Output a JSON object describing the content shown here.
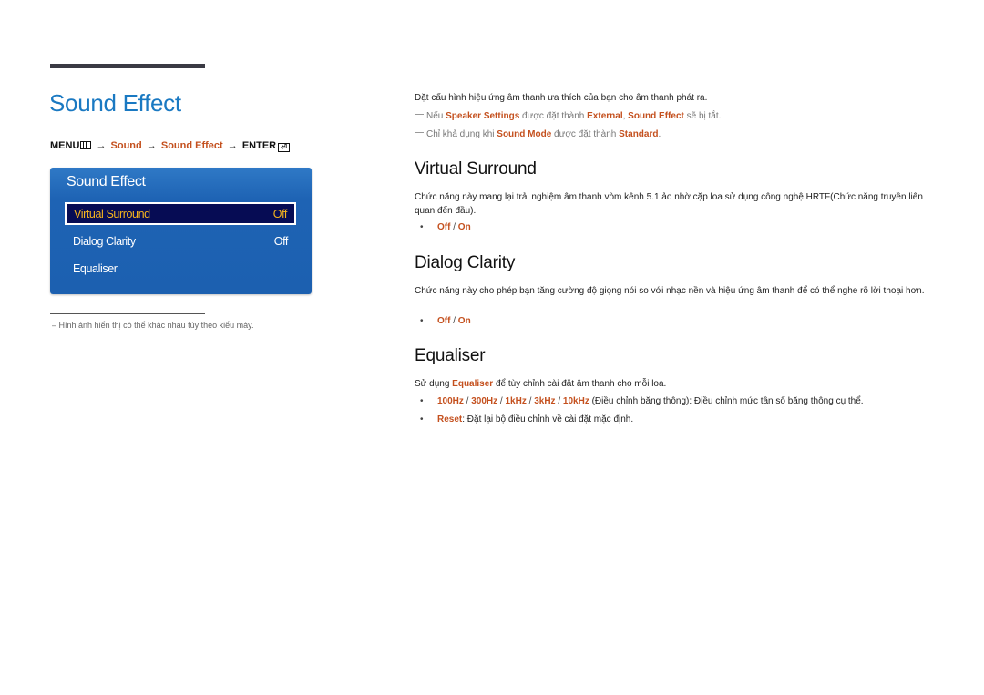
{
  "page": {
    "title": "Sound Effect",
    "menu_path": {
      "menu": "MENU",
      "arrow": "→",
      "sound": "Sound",
      "sound_effect": "Sound Effect",
      "enter": "ENTER",
      "menu_icon": "menu-icon",
      "enter_icon": "enter-icon"
    }
  },
  "osd": {
    "title": "Sound Effect",
    "items": [
      {
        "label": "Virtual Surround",
        "value": "Off",
        "selected": true
      },
      {
        "label": "Dialog Clarity",
        "value": "Off",
        "selected": false
      },
      {
        "label": "Equaliser",
        "value": "",
        "selected": false
      }
    ]
  },
  "footnote": "Hình ảnh hiển thị có thể khác nhau tùy theo kiểu máy.",
  "footnote_dash": "–",
  "intro": {
    "text": "Đặt cấu hình hiệu ứng âm thanh ưa thích của bạn cho âm thanh phát ra.",
    "note1": {
      "p1": "Nếu ",
      "k1": "Speaker Settings",
      "p2": " được đặt thành ",
      "k2": "External",
      "p3": ", ",
      "k3": "Sound Effect",
      "p4": " sẽ bị tắt."
    },
    "note2": {
      "p1": "Chỉ khả dụng khi ",
      "k1": "Sound Mode",
      "p2": " được đặt thành ",
      "k2": "Standard",
      "p3": "."
    }
  },
  "sections": {
    "virtual_surround": {
      "title": "Virtual Surround",
      "desc": "Chức năng này mang lại trải nghiệm âm thanh vòm kênh 5.1 ảo nhờ cặp loa sử dụng công nghệ HRTF(Chức năng truyền liên quan đến đầu).",
      "options": {
        "off": "Off",
        "sep": " / ",
        "on": "On"
      }
    },
    "dialog_clarity": {
      "title": "Dialog Clarity",
      "desc": "Chức năng này cho phép bạn tăng cường độ giọng nói so với nhạc nền và hiệu ứng âm thanh để có thể nghe rõ lời thoại hơn.",
      "options": {
        "off": "Off",
        "sep": " / ",
        "on": "On"
      }
    },
    "equaliser": {
      "title": "Equaliser",
      "desc": {
        "p1": "Sử dụng ",
        "k1": "Equaliser",
        "p2": " để tùy chỉnh cài đặt âm thanh cho mỗi loa."
      },
      "bullets": [
        {
          "bands": [
            "100Hz",
            "300Hz",
            "1kHz",
            "3kHz",
            "10kHz"
          ],
          "sep": " / ",
          "text": " (Điều chỉnh băng thông): Điều chỉnh mức tần số băng thông cụ thể."
        },
        {
          "key": "Reset",
          "text": ": Đặt lại bộ điều chỉnh về cài đặt mặc định."
        }
      ]
    }
  },
  "bullet_char": "•",
  "colors": {
    "title_blue": "#1a79c2",
    "accent_orange": "#c4501e",
    "osd_blue": "#1e63b4",
    "osd_selected_bg": "#060c54",
    "osd_selected_text": "#f5b41e"
  }
}
